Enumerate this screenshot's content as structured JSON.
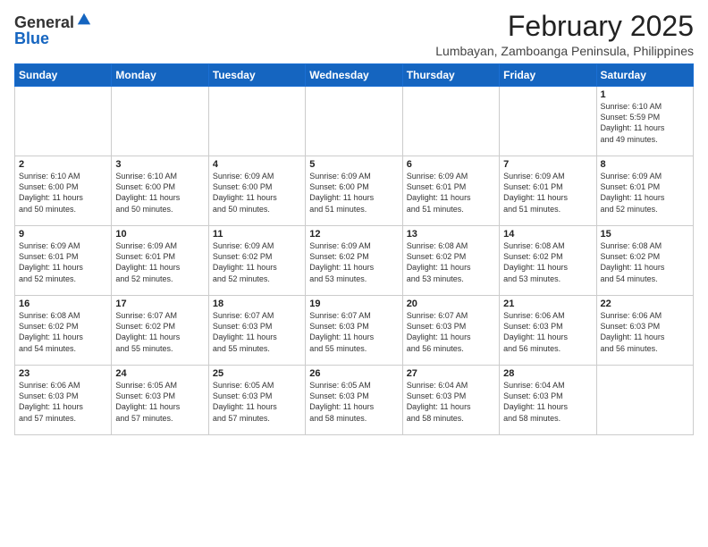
{
  "header": {
    "logo_general": "General",
    "logo_blue": "Blue",
    "title": "February 2025",
    "subtitle": "Lumbayan, Zamboanga Peninsula, Philippines"
  },
  "days_of_week": [
    "Sunday",
    "Monday",
    "Tuesday",
    "Wednesday",
    "Thursday",
    "Friday",
    "Saturday"
  ],
  "weeks": [
    [
      {
        "day": "",
        "info": ""
      },
      {
        "day": "",
        "info": ""
      },
      {
        "day": "",
        "info": ""
      },
      {
        "day": "",
        "info": ""
      },
      {
        "day": "",
        "info": ""
      },
      {
        "day": "",
        "info": ""
      },
      {
        "day": "1",
        "info": "Sunrise: 6:10 AM\nSunset: 5:59 PM\nDaylight: 11 hours\nand 49 minutes."
      }
    ],
    [
      {
        "day": "2",
        "info": "Sunrise: 6:10 AM\nSunset: 6:00 PM\nDaylight: 11 hours\nand 50 minutes."
      },
      {
        "day": "3",
        "info": "Sunrise: 6:10 AM\nSunset: 6:00 PM\nDaylight: 11 hours\nand 50 minutes."
      },
      {
        "day": "4",
        "info": "Sunrise: 6:09 AM\nSunset: 6:00 PM\nDaylight: 11 hours\nand 50 minutes."
      },
      {
        "day": "5",
        "info": "Sunrise: 6:09 AM\nSunset: 6:00 PM\nDaylight: 11 hours\nand 51 minutes."
      },
      {
        "day": "6",
        "info": "Sunrise: 6:09 AM\nSunset: 6:01 PM\nDaylight: 11 hours\nand 51 minutes."
      },
      {
        "day": "7",
        "info": "Sunrise: 6:09 AM\nSunset: 6:01 PM\nDaylight: 11 hours\nand 51 minutes."
      },
      {
        "day": "8",
        "info": "Sunrise: 6:09 AM\nSunset: 6:01 PM\nDaylight: 11 hours\nand 52 minutes."
      }
    ],
    [
      {
        "day": "9",
        "info": "Sunrise: 6:09 AM\nSunset: 6:01 PM\nDaylight: 11 hours\nand 52 minutes."
      },
      {
        "day": "10",
        "info": "Sunrise: 6:09 AM\nSunset: 6:01 PM\nDaylight: 11 hours\nand 52 minutes."
      },
      {
        "day": "11",
        "info": "Sunrise: 6:09 AM\nSunset: 6:02 PM\nDaylight: 11 hours\nand 52 minutes."
      },
      {
        "day": "12",
        "info": "Sunrise: 6:09 AM\nSunset: 6:02 PM\nDaylight: 11 hours\nand 53 minutes."
      },
      {
        "day": "13",
        "info": "Sunrise: 6:08 AM\nSunset: 6:02 PM\nDaylight: 11 hours\nand 53 minutes."
      },
      {
        "day": "14",
        "info": "Sunrise: 6:08 AM\nSunset: 6:02 PM\nDaylight: 11 hours\nand 53 minutes."
      },
      {
        "day": "15",
        "info": "Sunrise: 6:08 AM\nSunset: 6:02 PM\nDaylight: 11 hours\nand 54 minutes."
      }
    ],
    [
      {
        "day": "16",
        "info": "Sunrise: 6:08 AM\nSunset: 6:02 PM\nDaylight: 11 hours\nand 54 minutes."
      },
      {
        "day": "17",
        "info": "Sunrise: 6:07 AM\nSunset: 6:02 PM\nDaylight: 11 hours\nand 55 minutes."
      },
      {
        "day": "18",
        "info": "Sunrise: 6:07 AM\nSunset: 6:03 PM\nDaylight: 11 hours\nand 55 minutes."
      },
      {
        "day": "19",
        "info": "Sunrise: 6:07 AM\nSunset: 6:03 PM\nDaylight: 11 hours\nand 55 minutes."
      },
      {
        "day": "20",
        "info": "Sunrise: 6:07 AM\nSunset: 6:03 PM\nDaylight: 11 hours\nand 56 minutes."
      },
      {
        "day": "21",
        "info": "Sunrise: 6:06 AM\nSunset: 6:03 PM\nDaylight: 11 hours\nand 56 minutes."
      },
      {
        "day": "22",
        "info": "Sunrise: 6:06 AM\nSunset: 6:03 PM\nDaylight: 11 hours\nand 56 minutes."
      }
    ],
    [
      {
        "day": "23",
        "info": "Sunrise: 6:06 AM\nSunset: 6:03 PM\nDaylight: 11 hours\nand 57 minutes."
      },
      {
        "day": "24",
        "info": "Sunrise: 6:05 AM\nSunset: 6:03 PM\nDaylight: 11 hours\nand 57 minutes."
      },
      {
        "day": "25",
        "info": "Sunrise: 6:05 AM\nSunset: 6:03 PM\nDaylight: 11 hours\nand 57 minutes."
      },
      {
        "day": "26",
        "info": "Sunrise: 6:05 AM\nSunset: 6:03 PM\nDaylight: 11 hours\nand 58 minutes."
      },
      {
        "day": "27",
        "info": "Sunrise: 6:04 AM\nSunset: 6:03 PM\nDaylight: 11 hours\nand 58 minutes."
      },
      {
        "day": "28",
        "info": "Sunrise: 6:04 AM\nSunset: 6:03 PM\nDaylight: 11 hours\nand 58 minutes."
      },
      {
        "day": "",
        "info": ""
      }
    ]
  ]
}
